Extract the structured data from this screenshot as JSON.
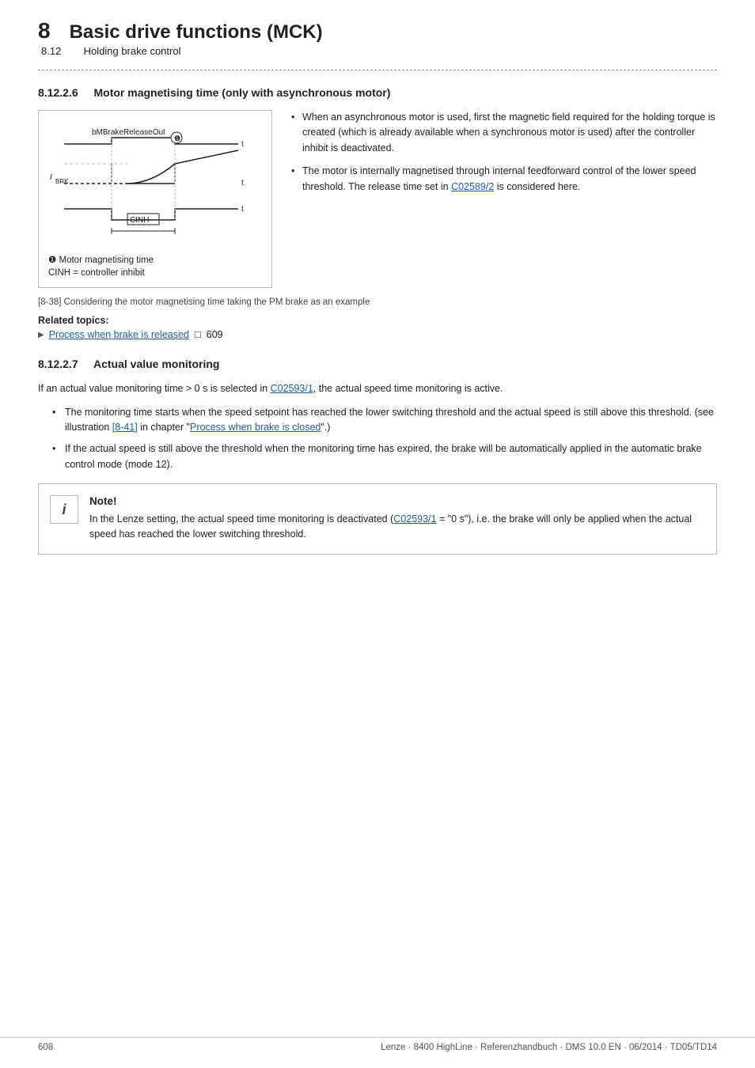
{
  "header": {
    "chapter_number": "8",
    "chapter_title": "Basic drive functions (MCK)",
    "section_number": "8.12",
    "section_title": "Holding brake control"
  },
  "section_8_12_2_6": {
    "number": "8.12.2.6",
    "title": "Motor magnetising time (only with asynchronous motor)",
    "diagram": {
      "label_bMBrakeReleaseOut": "bMBrakeReleaseOut",
      "label_IBRK": "I",
      "label_IBRK_sub": "BRK",
      "label_CINH": "CINH",
      "label_t1": "t",
      "label_t2": "t",
      "label_t3": "t",
      "annotation1": "❶",
      "legend_1": "❶ Motor magnetising time",
      "legend_CINH": "CINH = controller inhibit"
    },
    "bullet_points": [
      "When an asynchronous motor is used, first the magnetic field required for the holding torque is created (which is already available when a synchronous motor is used) after the controller inhibit is deactivated.",
      "The motor is internally magnetised through internal feedforward control of the lower speed threshold. The release time set in C02589/2 is considered here."
    ],
    "link_C02589": "C02589/2",
    "figure_caption_number": "[8-38]",
    "figure_caption_text": "Considering the motor magnetising time taking the PM brake as an example",
    "related_topics_heading": "Related topics:",
    "related_link_text": "Process when brake is released",
    "related_link_page": "609"
  },
  "section_8_12_2_7": {
    "number": "8.12.2.7",
    "title": "Actual value monitoring",
    "intro_text": "If an actual value monitoring time > 0 s is selected in C02593/1, the actual speed time monitoring is active.",
    "link_C02593_intro": "C02593/1",
    "bullet_points": [
      {
        "text": "The monitoring time starts when the speed setpoint has reached the lower switching threshold and the actual speed is still above this threshold. (see illustration [8-41] in chapter \"Process when brake is closed\".)",
        "link_841": "[8-41]",
        "link_process": "Process when brake is closed"
      },
      {
        "text": "If the actual speed is still above the threshold when the monitoring time has expired, the brake will be automatically applied in the automatic brake control mode (mode 12)."
      }
    ],
    "note": {
      "title": "Note!",
      "body_text": "In the Lenze setting, the actual speed time monitoring is deactivated (C02593/1 = \"0 s\"), i.e. the brake will only be applied when the actual speed has reached the lower switching threshold.",
      "link_C02593_note": "C02593/1"
    }
  },
  "footer": {
    "page_number": "608",
    "info": "Lenze · 8400 HighLine · Referenzhandbuch · DMS 10.0 EN · 06/2014 · TD05/TD14"
  }
}
